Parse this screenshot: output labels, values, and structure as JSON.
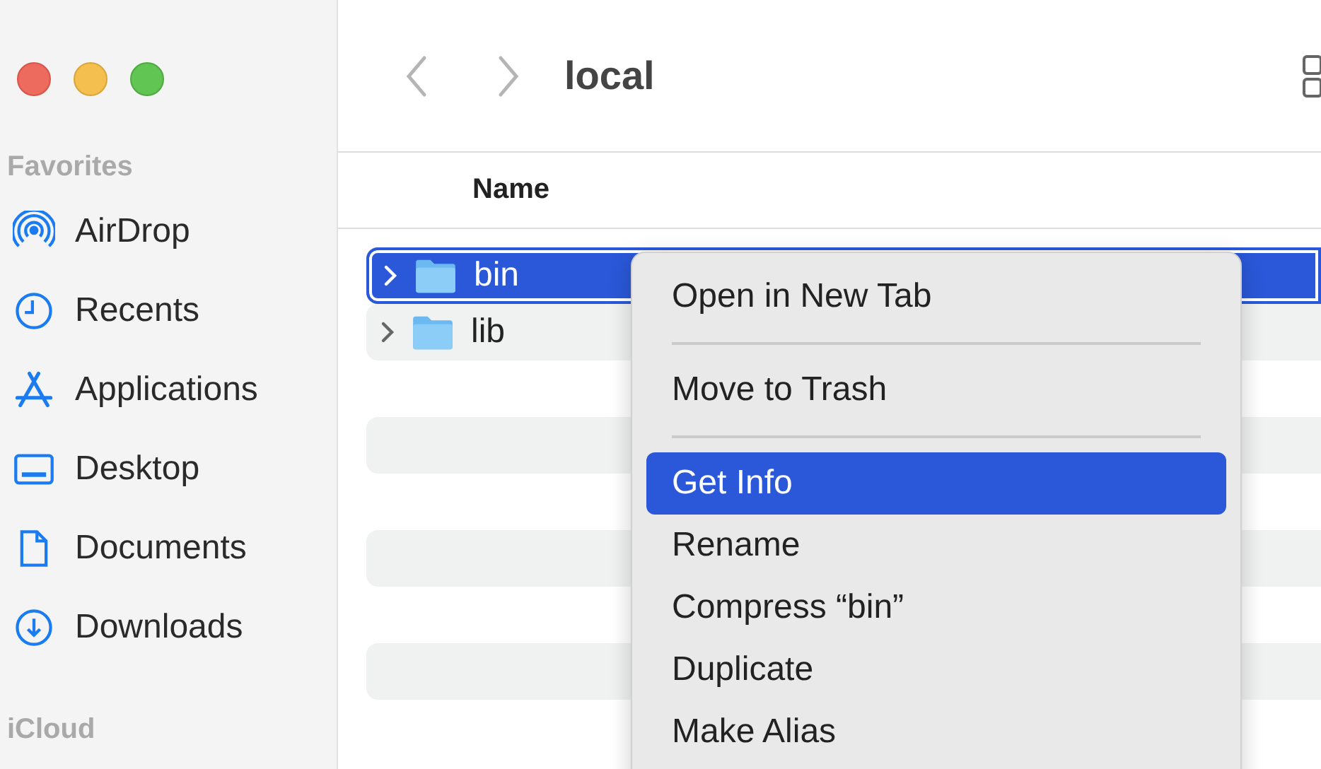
{
  "window": {
    "title": "local"
  },
  "sidebar": {
    "sections": [
      {
        "heading": "Favorites",
        "items": [
          {
            "label": "AirDrop",
            "kind": "airdrop"
          },
          {
            "label": "Recents",
            "kind": "recents"
          },
          {
            "label": "Applications",
            "kind": "applications"
          },
          {
            "label": "Desktop",
            "kind": "desktop"
          },
          {
            "label": "Documents",
            "kind": "documents"
          },
          {
            "label": "Downloads",
            "kind": "downloads"
          }
        ]
      },
      {
        "heading": "iCloud"
      }
    ]
  },
  "table": {
    "columns": [
      "Name"
    ],
    "rows": [
      {
        "name": "bin",
        "selected": true,
        "expanded": false
      },
      {
        "name": "lib",
        "selected": false,
        "expanded": false
      }
    ]
  },
  "context_menu": {
    "items": [
      {
        "kind": "item",
        "label": "Open in New Tab",
        "selected": false
      },
      {
        "kind": "separator"
      },
      {
        "kind": "item",
        "label": "Move to Trash",
        "selected": false
      },
      {
        "kind": "separator"
      },
      {
        "kind": "item",
        "label": "Get Info",
        "selected": true
      },
      {
        "kind": "item",
        "label": "Rename",
        "selected": false
      },
      {
        "kind": "item",
        "label": "Compress “bin”",
        "selected": false
      },
      {
        "kind": "item",
        "label": "Duplicate",
        "selected": false
      },
      {
        "kind": "item",
        "label": "Make Alias",
        "selected": false
      }
    ]
  }
}
